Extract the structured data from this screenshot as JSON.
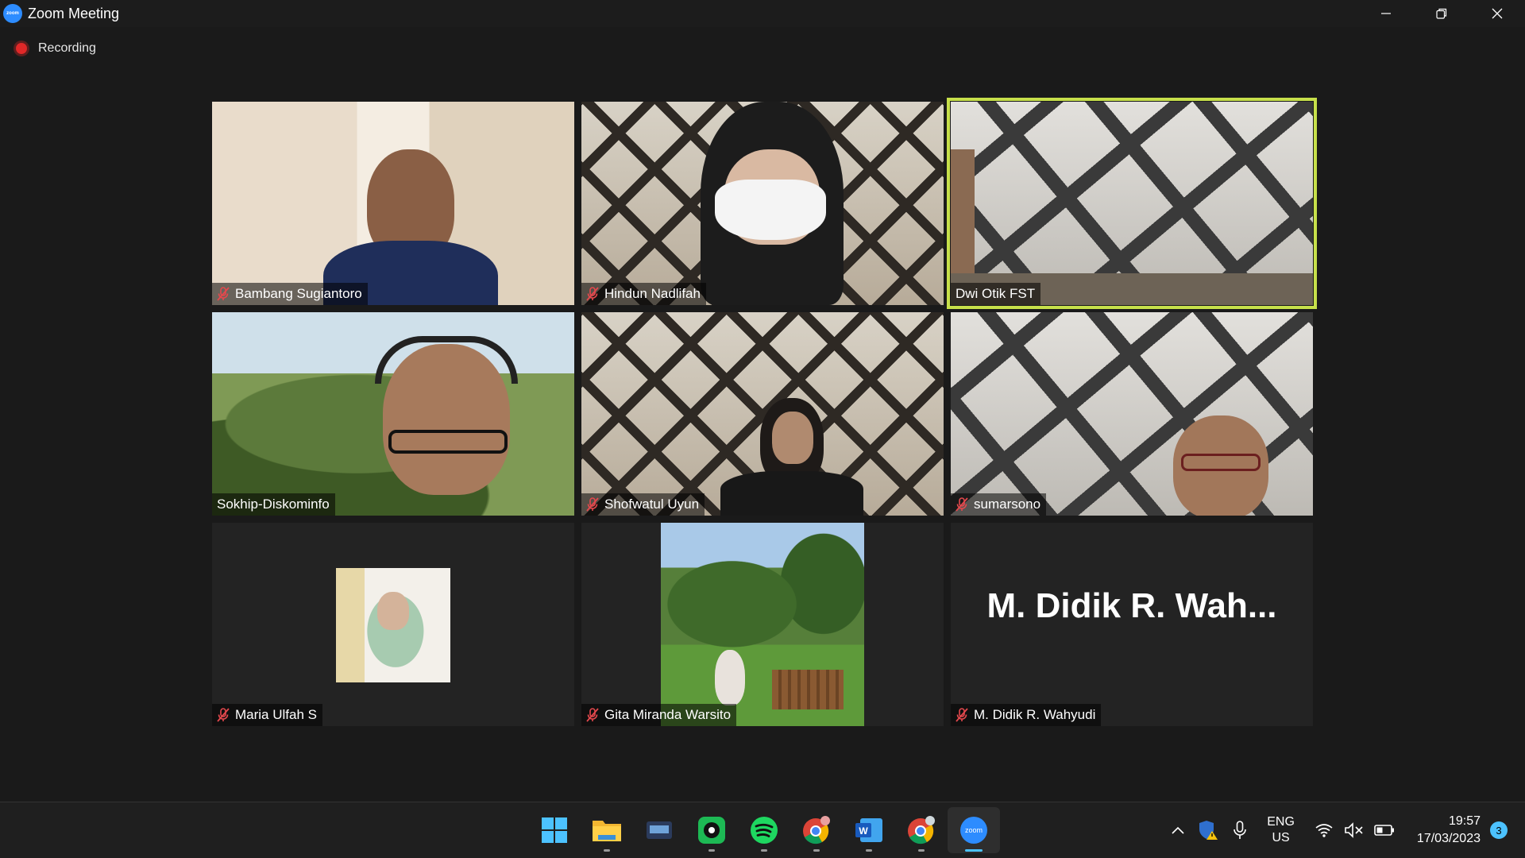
{
  "window": {
    "title": "Zoom Meeting",
    "logo_text": "zoom",
    "controls": [
      "minimize",
      "restore",
      "close"
    ]
  },
  "recording": {
    "label": "Recording",
    "color": "#e02828"
  },
  "participants": [
    {
      "name": "Bambang Sugiantoro",
      "muted": true
    },
    {
      "name": "Hindun Nadlifah",
      "muted": true
    },
    {
      "name": "Dwi Otik FST",
      "muted": false,
      "active_speaker": true
    },
    {
      "name": "Sokhip-Diskominfo",
      "muted": false
    },
    {
      "name": "Shofwatul Uyun",
      "muted": true
    },
    {
      "name": "sumarsono",
      "muted": true
    },
    {
      "name": "Maria Ulfah S",
      "muted": true
    },
    {
      "name": "Gita Miranda Warsito",
      "muted": true
    },
    {
      "name": "M. Didik R. Wahyudi",
      "muted": true,
      "display_name_large": "M. Didik R. Wah..."
    }
  ],
  "colors": {
    "active_speaker_border": "#c7e04a",
    "mute_icon": "#e5484d",
    "taskbar_accent": "#4cc2ff"
  },
  "taskbar": {
    "apps": [
      {
        "name": "start",
        "icon": "windows-logo-icon"
      },
      {
        "name": "file-explorer",
        "icon": "folder-icon"
      },
      {
        "name": "unknown-app",
        "icon": "terminal-icon"
      },
      {
        "name": "music-app",
        "icon": "disc-icon"
      },
      {
        "name": "spotify",
        "icon": "spotify-icon"
      },
      {
        "name": "chrome-1",
        "icon": "chrome-icon"
      },
      {
        "name": "word",
        "icon": "word-icon",
        "label": "W"
      },
      {
        "name": "chrome-2",
        "icon": "chrome-icon"
      },
      {
        "name": "zoom",
        "icon": "zoom-icon",
        "label": "zoom",
        "active": true
      }
    ],
    "language": {
      "line1": "ENG",
      "line2": "US"
    },
    "time": "19:57",
    "date": "17/03/2023",
    "notifications": "3"
  }
}
